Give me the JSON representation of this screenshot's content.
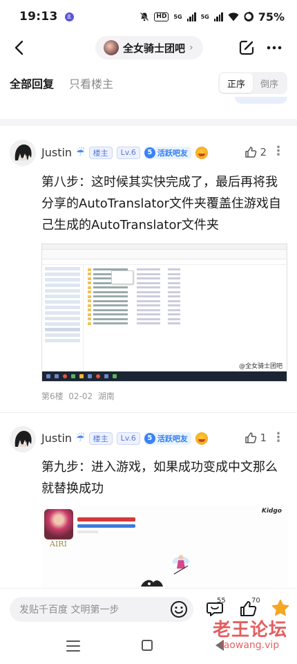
{
  "status_bar": {
    "time": "19:13",
    "notif_badge": "ß",
    "hd_label": "HD",
    "net1": "5G",
    "net2": "5G",
    "battery": "75%"
  },
  "nav": {
    "forum_name": "全女骑士团吧",
    "forum_chevron": "›"
  },
  "tabs": {
    "all_replies": "全部回复",
    "op_only": "只看楼主",
    "order_asc": "正序",
    "order_desc": "倒序"
  },
  "posts": [
    {
      "username": "Justin",
      "host_badge": "楼主",
      "level": "Lv.6",
      "active_num": "5",
      "active_label": "活跃吧友",
      "likes": "2",
      "body": "第八步：这时候其实快完成了，最后再将我分享的AutoTranslator文件夹覆盖住游戏自己生成的AutoTranslator文件夹",
      "image_watermark": "@全女骑士团吧",
      "floor": "第6楼",
      "date": "02-02",
      "location": "湖南"
    },
    {
      "username": "Justin",
      "host_badge": "楼主",
      "level": "Lv.6",
      "active_num": "5",
      "active_label": "活跃吧友",
      "likes": "1",
      "body": "第九步：进入游戏，如果成功变成中文那么就替换成功",
      "image_name_label": "AIRI",
      "image_logo": "Kidgo"
    }
  ],
  "reply_bar": {
    "placeholder": "发贴千百度 文明第一步",
    "comment_count": "55",
    "like_count": "70"
  },
  "watermark": {
    "main": "老王论坛",
    "sub": "laowang.vip"
  },
  "colors": {
    "accent_blue": "#3b82f6",
    "star_orange": "#f5a623",
    "watermark_red": "#e2474a"
  }
}
